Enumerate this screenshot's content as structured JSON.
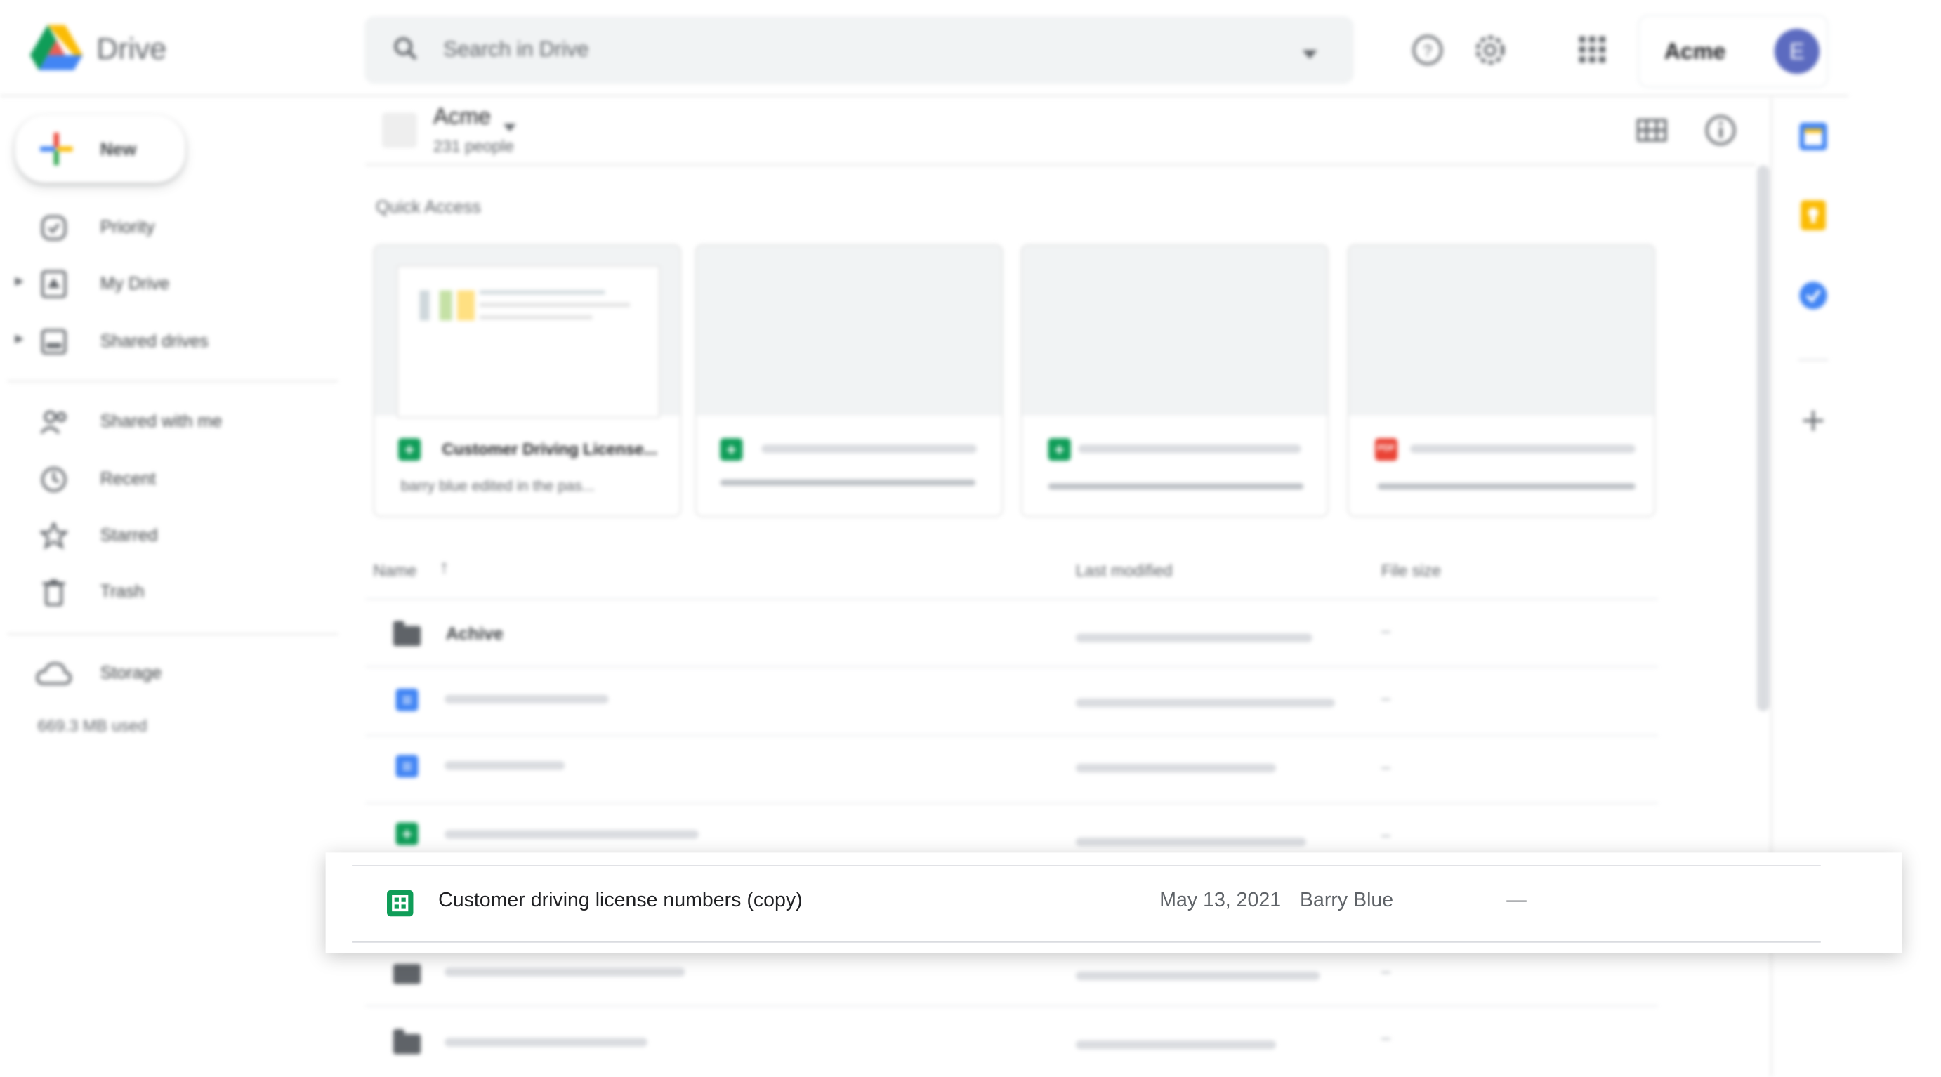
{
  "header": {
    "app_name": "Drive",
    "search_placeholder": "Search in Drive",
    "account_label": "Acme",
    "avatar_initial": "E"
  },
  "sidebar": {
    "new_label": "New",
    "items": [
      {
        "label": "Priority"
      },
      {
        "label": "My Drive"
      },
      {
        "label": "Shared drives"
      },
      {
        "label": "Shared with me"
      },
      {
        "label": "Recent"
      },
      {
        "label": "Starred"
      },
      {
        "label": "Trash"
      },
      {
        "label": "Storage"
      }
    ],
    "storage_used": "669.3 MB used"
  },
  "workspace": {
    "name": "Acme",
    "members": "231 people"
  },
  "quick_access": {
    "heading": "Quick Access",
    "first_card": {
      "title": "Customer Driving License...",
      "subtitle": "barry blue edited in the pas..."
    }
  },
  "file_list": {
    "columns": {
      "name": "Name",
      "last_modified": "Last modified",
      "file_size": "File size"
    },
    "sort_indicator": "↑",
    "first_row_name": "Achive",
    "size_placeholder": "–"
  },
  "highlight_row": {
    "name": "Customer driving license numbers (copy)",
    "date": "May 13, 2021",
    "owner": "Barry Blue",
    "size": "—"
  },
  "colors": {
    "sheets_green": "#0f9d58",
    "docs_blue": "#4285f4",
    "pdf_red": "#ea4335",
    "avatar_purple": "#5c6bc0"
  }
}
